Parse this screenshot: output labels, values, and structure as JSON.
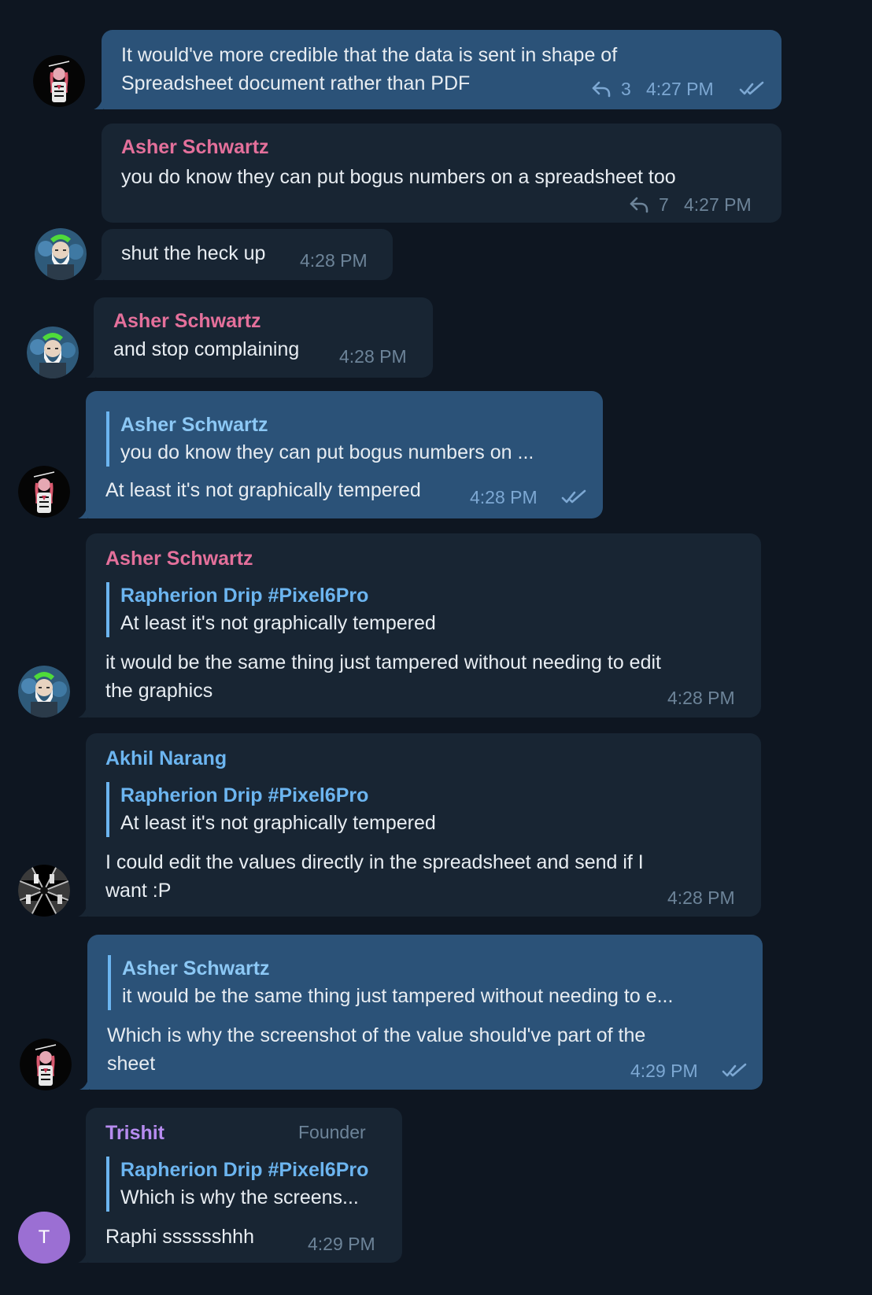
{
  "colors": {
    "background": "#0e1621",
    "incoming_bubble": "#182533",
    "outgoing_bubble": "#2b5278",
    "name_pink": "#e4709b",
    "name_blue": "#6cb5f0",
    "name_violet": "#b78cf0",
    "trishit_avatar": "#9b6fd3"
  },
  "messages": [
    {
      "text_line1": "It would've more credible that the data is sent in shape of",
      "text_line2": "Spreadsheet document rather than PDF",
      "reply_count": "3",
      "time": "4:27 PM",
      "icons": [
        "reply-icon",
        "double-check-icon"
      ]
    },
    {
      "sender": "Asher Schwartz",
      "text": "you do know they can put bogus numbers on a spreadsheet too",
      "reply_count": "7",
      "time": "4:27 PM",
      "icons": [
        "reply-icon"
      ]
    },
    {
      "text": "shut the heck up",
      "time": "4:28 PM"
    },
    {
      "sender": "Asher Schwartz",
      "text": "and stop complaining",
      "time": "4:28 PM"
    },
    {
      "quote_name": "Asher Schwartz",
      "quote_text": "you do know they can put bogus numbers on ...",
      "text": "At least it's not graphically tempered",
      "time": "4:28 PM",
      "icons": [
        "double-check-icon"
      ]
    },
    {
      "sender": "Asher Schwartz",
      "quote_name": "Rapherion Drip #Pixel6Pro",
      "quote_text": "At least it's not graphically tempered",
      "text_line1": "it would be the same thing just tampered without needing to edit",
      "text_line2": "the graphics",
      "time": "4:28 PM"
    },
    {
      "sender": "Akhil Narang",
      "quote_name": "Rapherion Drip #Pixel6Pro",
      "quote_text": "At least it's not graphically tempered",
      "text_line1": "I could edit the values directly in the spreadsheet and send if I",
      "text_line2": "want :P",
      "time": "4:28 PM"
    },
    {
      "quote_name": "Asher Schwartz",
      "quote_text": "it would be the same thing just tampered without needing to e...",
      "text_line1": "Which is why the screenshot of the value should've part of the",
      "text_line2": "sheet",
      "time": "4:29 PM",
      "icons": [
        "double-check-icon"
      ]
    },
    {
      "sender": "Trishit",
      "role": "Founder",
      "quote_name": "Rapherion Drip #Pixel6Pro",
      "quote_text": "Which is why the screens...",
      "text": "Raphi sssssshhh",
      "time": "4:29 PM",
      "avatar_initial": "T"
    }
  ]
}
